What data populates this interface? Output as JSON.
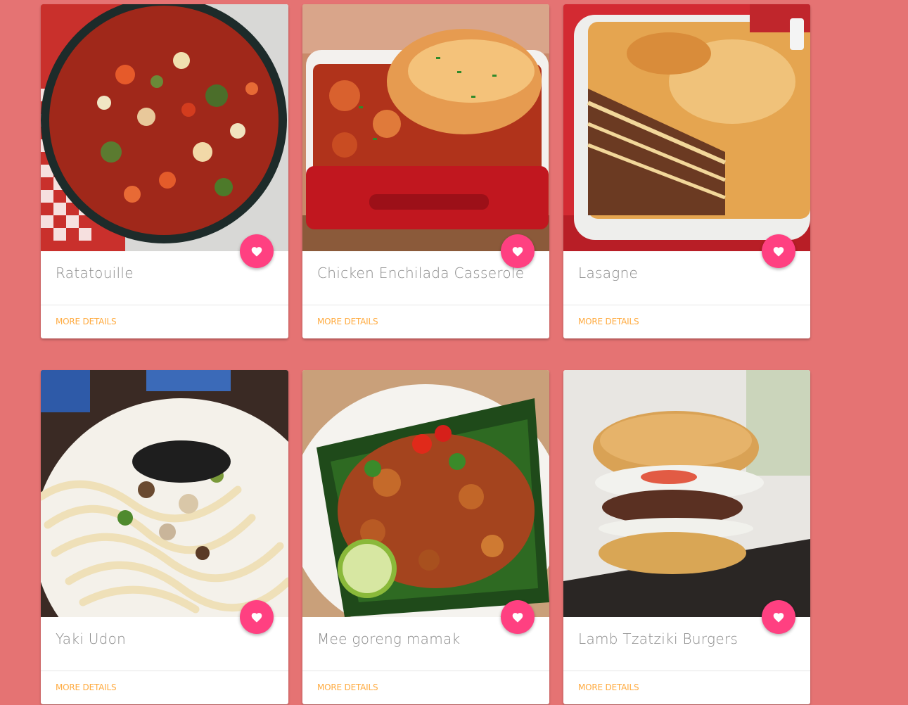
{
  "colors": {
    "page_background": "#e57373",
    "fab_background": "#ff4081",
    "action_link": "#ffab40",
    "title_text": "#8a8a8a"
  },
  "recipes": [
    {
      "title": "Ratatouille",
      "action_label": "MORE DETAILS",
      "image": "ratatouille-photo",
      "fav_icon": "heart-icon"
    },
    {
      "title": "Chicken Enchilada Casserole",
      "action_label": "MORE DETAILS",
      "image": "enchilada-casserole-photo",
      "fav_icon": "heart-icon"
    },
    {
      "title": "Lasagne",
      "action_label": "MORE DETAILS",
      "image": "lasagne-photo",
      "fav_icon": "heart-icon"
    },
    {
      "title": "Yaki Udon",
      "action_label": "MORE DETAILS",
      "image": "yaki-udon-photo",
      "fav_icon": "heart-icon"
    },
    {
      "title": "Mee goreng mamak",
      "action_label": "MORE DETAILS",
      "image": "mee-goreng-photo",
      "fav_icon": "heart-icon"
    },
    {
      "title": "Lamb Tzatziki Burgers",
      "action_label": "MORE DETAILS",
      "image": "lamb-burger-photo",
      "fav_icon": "heart-icon"
    }
  ]
}
